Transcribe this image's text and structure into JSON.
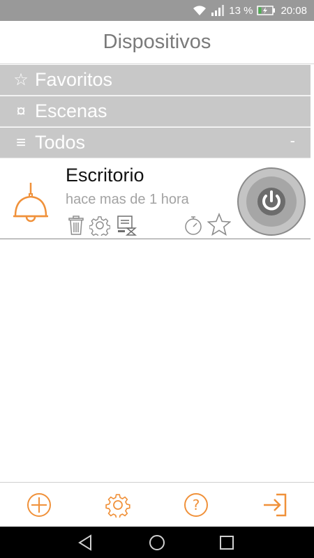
{
  "status_bar": {
    "battery_percent": "13 %",
    "time": "20:08",
    "icons": [
      "wifi-icon",
      "signal-icon",
      "battery-charging-icon"
    ]
  },
  "header": {
    "title": "Dispositivos"
  },
  "sections": [
    {
      "icon": "star-outline-icon",
      "icon_glyph": "☆",
      "label": "Favoritos"
    },
    {
      "icon": "scenes-icon",
      "icon_glyph": "¤",
      "label": "Escenas"
    },
    {
      "icon": "list-icon",
      "icon_glyph": "≡",
      "label": "Todos",
      "toggle": "-"
    }
  ],
  "devices": [
    {
      "name": "Escritorio",
      "last_seen": "hace mas de 1 hora",
      "icon": "lamp-icon",
      "actions": [
        "trash-icon",
        "gear-icon",
        "schedule-icon",
        "timer-icon",
        "star-icon"
      ],
      "state": "off"
    }
  ],
  "toolbar": {
    "buttons": [
      "add-icon",
      "settings-icon",
      "help-icon",
      "logout-icon"
    ],
    "accent_color": "#f0913a"
  },
  "nav_bar": {
    "buttons": [
      "back-icon",
      "home-icon",
      "recents-icon"
    ]
  }
}
